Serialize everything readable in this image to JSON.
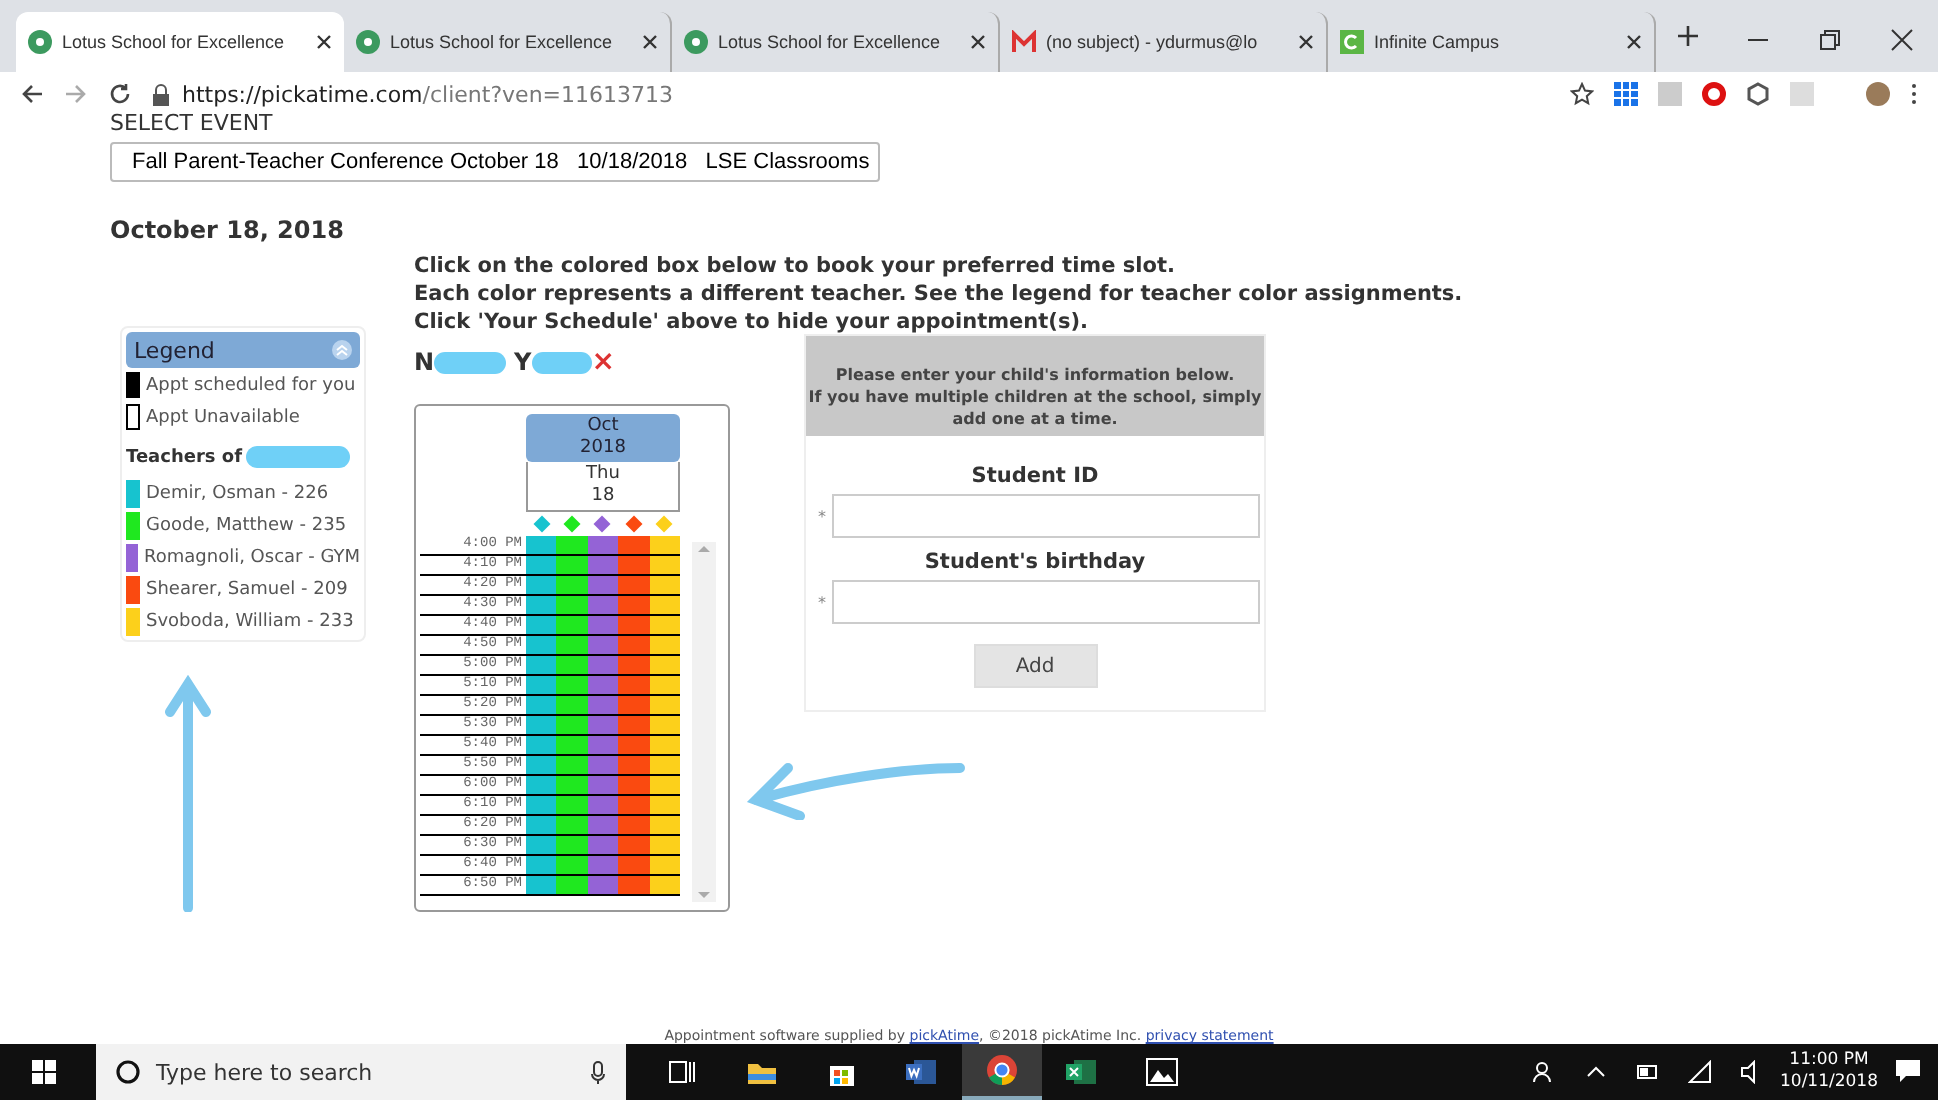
{
  "browser": {
    "tabs": [
      {
        "title": "Lotus School for Excellence",
        "kind": "circle",
        "selected": true
      },
      {
        "title": "Lotus School for Excellence",
        "kind": "circle",
        "selected": false
      },
      {
        "title": "Lotus School for Excellence",
        "kind": "circle",
        "selected": false
      },
      {
        "title": "(no subject) - ydurmus@lo",
        "kind": "mail",
        "selected": false
      },
      {
        "title": "Infinite Campus",
        "kind": "square",
        "selected": false
      }
    ],
    "url_host": "https://pickatime.com",
    "url_path": "/client?ven=11613713"
  },
  "event": {
    "label": "SELECT EVENT",
    "value": "Fall Parent-Teacher Conference October 18   10/18/2018   LSE Classrooms"
  },
  "date_heading": "October 18, 2018",
  "instructions": [
    "Click on the colored box below to book your preferred time slot.",
    "Each color represents a different teacher. See the legend for teacher color assignments.",
    "Click 'Your Schedule' above to hide your appointment(s)."
  ],
  "legend": {
    "title": "Legend",
    "expanded": true,
    "keys": [
      {
        "label": "Appt scheduled for you",
        "kind": "filled"
      },
      {
        "label": "Appt Unavailable",
        "kind": "empty"
      }
    ],
    "teachers_heading": "Teachers of",
    "teachers": [
      {
        "name": "Demir, Osman - 226",
        "color": "#17c3cf"
      },
      {
        "name": "Goode, Matthew - 235",
        "color": "#1fe81f"
      },
      {
        "name": "Romagnoli, Oscar - GYM",
        "color": "#9463d6"
      },
      {
        "name": "Shearer, Samuel - 209",
        "color": "#fa4a10"
      },
      {
        "name": "Svoboda, William - 233",
        "color": "#fcd01b"
      }
    ]
  },
  "student": {
    "first_initial": "N",
    "last_initial": "Y",
    "remove": "×"
  },
  "calendar": {
    "month": "Oct",
    "year": "2018",
    "weekday": "Thu",
    "day": "18",
    "times": [
      "4:00 PM",
      "4:10 PM",
      "4:20 PM",
      "4:30 PM",
      "4:40 PM",
      "4:50 PM",
      "5:00 PM",
      "5:10 PM",
      "5:20 PM",
      "5:30 PM",
      "5:40 PM",
      "5:50 PM",
      "6:00 PM",
      "6:10 PM",
      "6:20 PM",
      "6:30 PM",
      "6:40 PM",
      "6:50 PM"
    ]
  },
  "form": {
    "notice": "Please enter your child's information below.\nIf you have multiple children at the school, simply add one at a time.",
    "fields": [
      {
        "label": "Student ID",
        "required_mark": "*"
      },
      {
        "label": "Student's birthday",
        "required_mark": "*"
      }
    ],
    "button": "Add"
  },
  "footer": {
    "text": "Appointment software supplied by ",
    "link": "pickAtime",
    "text_after": ", ©2018 pickAtime Inc. ",
    "privacy_link": "privacy statement"
  },
  "taskbar": {
    "search_placeholder": "Type here to search",
    "apps": [
      {
        "kind": "taskview",
        "selected": false
      },
      {
        "kind": "folder",
        "selected": false
      },
      {
        "kind": "store",
        "selected": false
      },
      {
        "kind": "word",
        "selected": false
      },
      {
        "kind": "chrome",
        "selected": true
      },
      {
        "kind": "excel",
        "selected": false
      },
      {
        "kind": "photos",
        "selected": false
      }
    ],
    "time": "11:00 PM",
    "date": "10/11/2018"
  }
}
